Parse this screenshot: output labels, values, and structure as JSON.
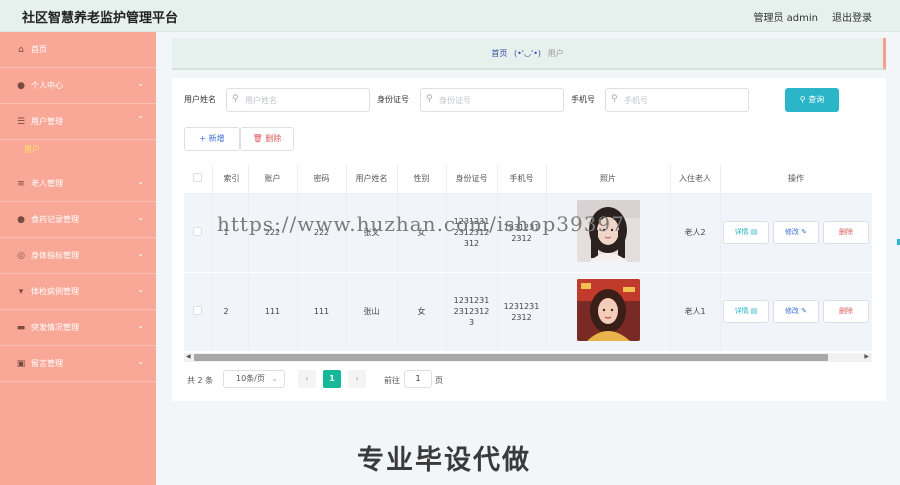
{
  "app": {
    "title": "社区智慧养老监护管理平台",
    "admin_label": "管理员 admin",
    "logout": "退出登录"
  },
  "sidebar": {
    "items": [
      {
        "icon": "home-icon",
        "label": "首页",
        "has_arrow": false
      },
      {
        "icon": "user-icon",
        "label": "个人中心",
        "has_arrow": true
      },
      {
        "icon": "sliders-icon",
        "label": "用户管理",
        "has_arrow": true,
        "expanded": true
      },
      {
        "icon": "list-icon",
        "label": "老人管理",
        "has_arrow": true
      },
      {
        "icon": "user-icon",
        "label": "食药记录管理",
        "has_arrow": true
      },
      {
        "icon": "target-icon",
        "label": "身体指标管理",
        "has_arrow": true
      },
      {
        "icon": "medical-icon",
        "label": "体检病例管理",
        "has_arrow": true
      },
      {
        "icon": "briefcase-icon",
        "label": "突发情况管理",
        "has_arrow": true
      },
      {
        "icon": "note-icon",
        "label": "留言管理",
        "has_arrow": true
      }
    ],
    "submenu_active": "用户"
  },
  "breadcrumb": {
    "home": "首页",
    "emoji": "(•'◡'•)",
    "current": "用户"
  },
  "search": {
    "name_label": "用户姓名",
    "name_placeholder": "用户姓名",
    "id_label": "身份证号",
    "id_placeholder": "身份证号",
    "phone_label": "手机号",
    "phone_placeholder": "手机号",
    "query_button": "查询"
  },
  "actions": {
    "add": "+ 新增",
    "delete": "删除"
  },
  "watermark": "https://www.huzhan.com/ishop39397",
  "table": {
    "headers": {
      "index": "索引",
      "account": "账户",
      "password": "密码",
      "username": "用户姓名",
      "gender": "性别",
      "id_number": "身份证号",
      "phone": "手机号",
      "photo": "照片",
      "elder": "入住老人",
      "ops": "操作"
    },
    "rows": [
      {
        "index": "1",
        "account": "222",
        "password": "222",
        "username": "张文",
        "gender": "女",
        "id_number": [
          "1231231",
          "2312312",
          "312"
        ],
        "phone": [
          "1231231",
          "2312"
        ],
        "photo": "portrait-photo-1",
        "elder": "老人2"
      },
      {
        "index": "2",
        "account": "111",
        "password": "111",
        "username": "张山",
        "gender": "女",
        "id_number": [
          "1231231",
          "2312312",
          "3"
        ],
        "phone": [
          "1231231",
          "2312"
        ],
        "photo": "portrait-photo-2",
        "elder": "老人1"
      }
    ],
    "op_labels": {
      "detail": "详情",
      "edit": "修改",
      "delete": "删除"
    }
  },
  "pagination": {
    "total": "共 2 条",
    "page_size": "10条/页",
    "current_page": "1",
    "goto_label": "前往",
    "goto_value": "1",
    "page_word": "页"
  },
  "promo": "专业毕设代做",
  "colors": {
    "sidebar_bg": "#f9a898",
    "header_bg": "#e6f0ec",
    "query_btn": "#2ab6c8",
    "active_page": "#16b89a",
    "submenu_active": "#ffe45c"
  }
}
